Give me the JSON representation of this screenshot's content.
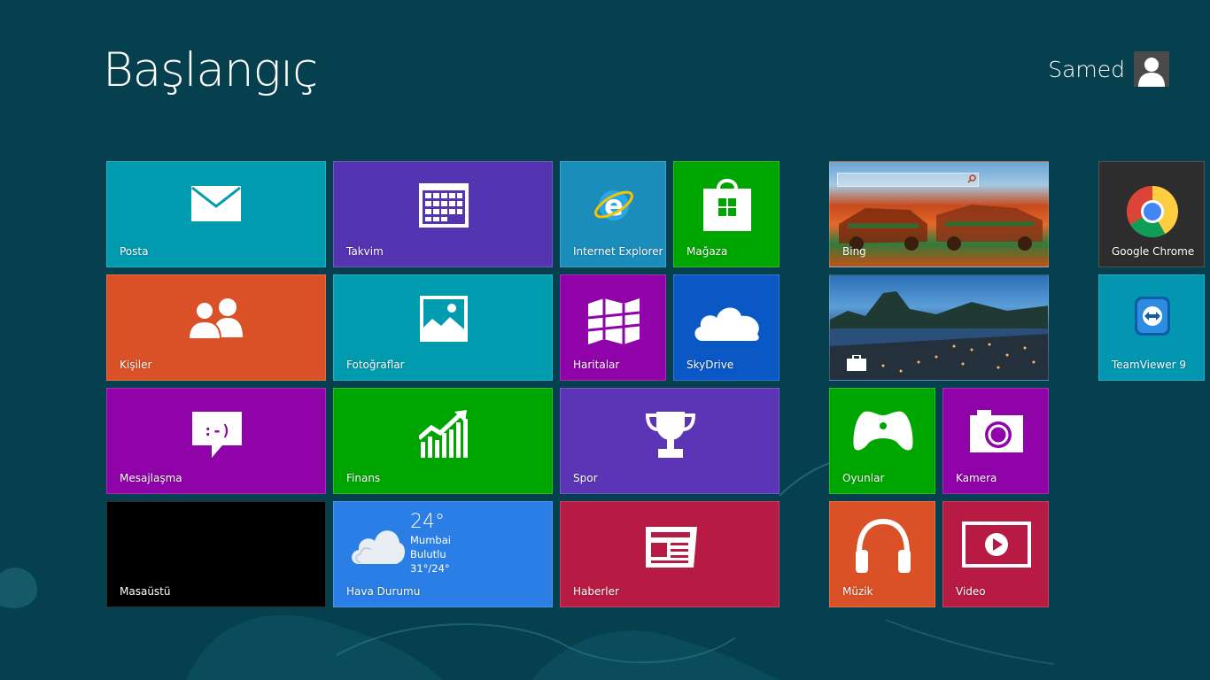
{
  "screen": {
    "title": "Başlangıç"
  },
  "user": {
    "name": "Samed"
  },
  "tiles": {
    "posta": {
      "label": "Posta",
      "color": "#009baf"
    },
    "takvim": {
      "label": "Takvim",
      "color": "#5534b1"
    },
    "ie": {
      "label": "Internet Explorer",
      "color": "#1a8dbb"
    },
    "magaza": {
      "label": "Mağaza",
      "color": "#00a600"
    },
    "bing": {
      "label": "Bing"
    },
    "chrome": {
      "label": "Google Chrome",
      "color": "#2d2d2d"
    },
    "kisiler": {
      "label": "Kişiler",
      "color": "#db5127"
    },
    "fotograflar": {
      "label": "Fotoğraflar",
      "color": "#009baf"
    },
    "haritalar": {
      "label": "Haritalar",
      "color": "#8f03a8"
    },
    "skydrive": {
      "label": "SkyDrive",
      "color": "#0a58c6"
    },
    "travel": {
      "label": ""
    },
    "teamviewer": {
      "label": "TeamViewer 9",
      "color": "#0296b0"
    },
    "mesajlasma": {
      "label": "Mesajlaşma",
      "color": "#8f03a8"
    },
    "finans": {
      "label": "Finans",
      "color": "#00a600"
    },
    "spor": {
      "label": "Spor",
      "color": "#5b35b5"
    },
    "oyunlar": {
      "label": "Oyunlar",
      "color": "#00a600"
    },
    "kamera": {
      "label": "Kamera",
      "color": "#8f03a8"
    },
    "masaustu": {
      "label": "Masaüstü",
      "color": "#000000"
    },
    "hava": {
      "label": "Hava Durumu",
      "color": "#2a7ee6",
      "temp": "24°",
      "city": "Mumbai",
      "condition": "Bulutlu",
      "range": "31°/24°"
    },
    "haberler": {
      "label": "Haberler",
      "color": "#b71b44"
    },
    "muzik": {
      "label": "Müzik",
      "color": "#db5127"
    },
    "video": {
      "label": "Video",
      "color": "#b71b44"
    }
  },
  "icons": {
    "posta": "mail-icon",
    "takvim": "calendar-icon",
    "ie": "internet-explorer-icon",
    "magaza": "store-bag-icon",
    "chrome": "chrome-icon",
    "kisiler": "people-icon",
    "fotograflar": "photo-icon",
    "haritalar": "map-icon",
    "skydrive": "cloud-icon",
    "teamviewer": "teamviewer-icon",
    "mesajlasma": "chat-bubble-icon",
    "finans": "chart-icon",
    "spor": "trophy-icon",
    "oyunlar": "gamepad-icon",
    "kamera": "camera-icon",
    "hava": "cloud-weather-icon",
    "haberler": "newspaper-icon",
    "muzik": "headphones-icon",
    "video": "play-video-icon"
  }
}
